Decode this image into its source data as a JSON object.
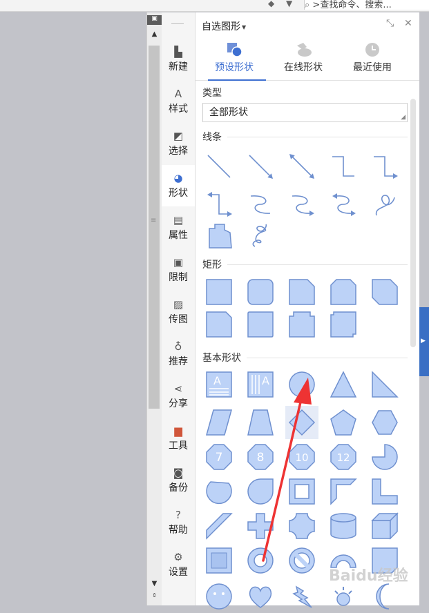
{
  "topbar": {
    "search_text": ">查找命令、搜索..."
  },
  "nav": {
    "items": [
      {
        "label": "新建",
        "icon": "new-file-icon"
      },
      {
        "label": "样式",
        "icon": "style-icon"
      },
      {
        "label": "选择",
        "icon": "select-icon"
      },
      {
        "label": "形状",
        "icon": "shape-icon"
      },
      {
        "label": "属性",
        "icon": "properties-icon"
      },
      {
        "label": "限制",
        "icon": "lock-icon"
      },
      {
        "label": "传图",
        "icon": "image-icon"
      },
      {
        "label": "推荐",
        "icon": "recommend-icon"
      },
      {
        "label": "分享",
        "icon": "share-icon"
      },
      {
        "label": "工具",
        "icon": "toolbox-icon"
      },
      {
        "label": "备份",
        "icon": "backup-icon"
      },
      {
        "label": "帮助",
        "icon": "help-icon"
      },
      {
        "label": "设置",
        "icon": "gear-icon"
      }
    ]
  },
  "panel": {
    "title": "自选图形",
    "tabs": [
      {
        "label": "预设形状",
        "icon": "preset-shapes-icon"
      },
      {
        "label": "在线形状",
        "icon": "online-shapes-icon"
      },
      {
        "label": "最近使用",
        "icon": "clock-icon"
      }
    ],
    "type_label": "类型",
    "type_value": "全部形状",
    "sections": {
      "lines": "线条",
      "rects": "矩形",
      "basic": "基本形状"
    },
    "octagon_numbers": [
      "7",
      "8",
      "10",
      "12"
    ]
  },
  "colors": {
    "accent": "#3e6fd1",
    "shape_fill": "#bcd2f7",
    "shape_stroke": "#6f90cf",
    "arrow": "#ee3333"
  },
  "watermark": "Baidu经验"
}
